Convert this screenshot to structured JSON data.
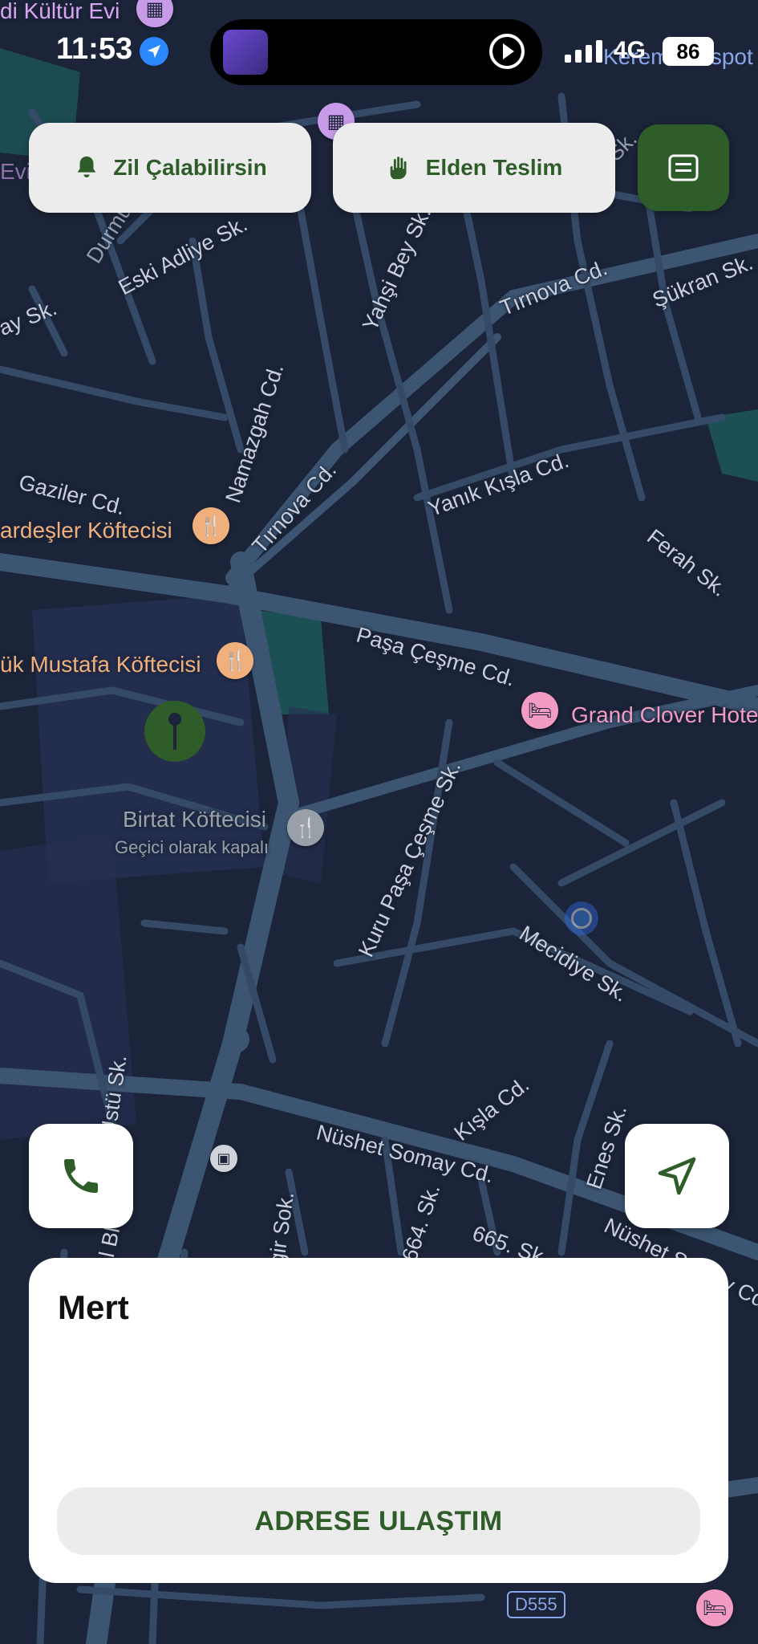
{
  "status_bar": {
    "time": "11:53",
    "network": "4G",
    "battery": "86",
    "hotspot_text": "Kerem Hotspot"
  },
  "actions": {
    "ring_bell": "Zil Çalabilirsin",
    "hand_delivery": "Elden Teslim"
  },
  "map": {
    "streets": [
      "Eski Adliye Sk.",
      "Durmuş Sk.",
      "Yahşi Bey Sk.",
      "Tırnova Cd.",
      "Şükran Sk.",
      "Namazgah Cd.",
      "Gaziler Cd.",
      "Tırnova Cd.",
      "Yanık Kışla Cd.",
      "Ferah Sk.",
      "Paşa Çeşme Cd.",
      "Kuru Paşa Çeşme Sk.",
      "Mecidiye Sk.",
      "Kışla Cd.",
      "Nüshet Somay Cd.",
      "664. Sk.",
      "665. Sk.",
      "Nüshet Somay Cd.",
      "Enes Sk.",
      "Acem Sk.",
      "ay Sk.",
      "Üstü Sk.",
      "gir Sok.",
      "al Bl."
    ],
    "pois": {
      "kultur_evi": "di Kültür Evi",
      "evi": "Evi",
      "kardesler": "ardeşler Köftecisi",
      "mustafa": "ük Mustafa Köftecisi",
      "birtat": "Birtat Köftecisi",
      "birtat_status": "Geçici olarak kapalı",
      "grand_clover": "Grand Clover Hote",
      "road_number": "D555"
    }
  },
  "customer": {
    "name": "Mert"
  },
  "arrive_button": "ADRESE ULAŞTIM",
  "colors": {
    "accent_green": "#2f5d2a",
    "map_bg": "#1b2438",
    "road": "#3c5572",
    "location_blue": "#3d8bfd"
  }
}
